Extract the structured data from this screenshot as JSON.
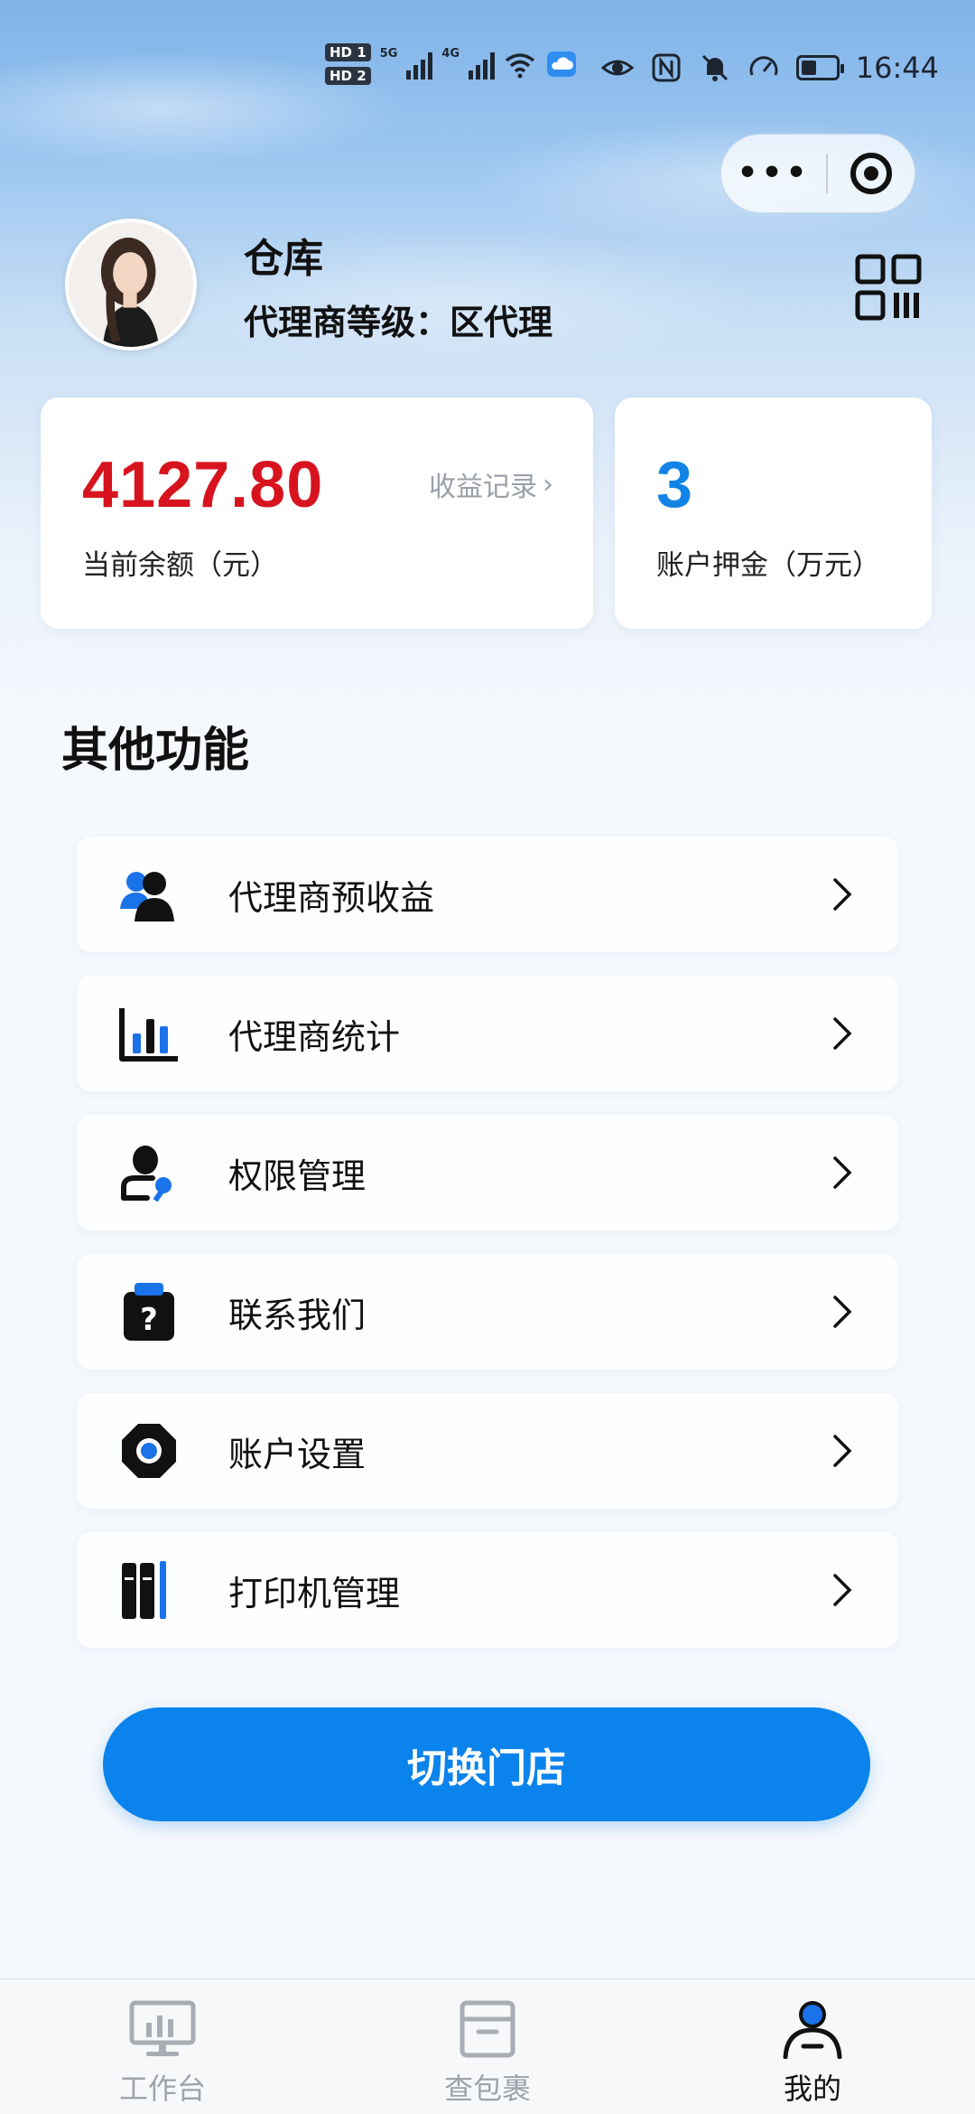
{
  "status_bar": {
    "time": "16:44",
    "hd1": "HD 1",
    "hd2": "HD 2",
    "net1": "5G",
    "net2": "4G",
    "icons": [
      "signal-icon",
      "wifi-icon",
      "cloud-icon",
      "eye-icon",
      "nfc-icon",
      "mute-icon",
      "speed-icon",
      "battery-icon"
    ]
  },
  "capsule": {
    "more_label": "•••"
  },
  "profile": {
    "name": "仓库",
    "level": "代理商等级：区代理"
  },
  "balance_card": {
    "value": "4127.80",
    "label": "当前余额（元）",
    "link_label": "收益记录",
    "link_chevron": "›"
  },
  "deposit_card": {
    "value": "3",
    "label": "账户押金（万元）"
  },
  "section": {
    "title": "其他功能"
  },
  "menu": {
    "items": [
      {
        "label": "代理商预收益",
        "icon": "users-icon"
      },
      {
        "label": "代理商统计",
        "icon": "bar-chart-icon"
      },
      {
        "label": "权限管理",
        "icon": "user-key-icon"
      },
      {
        "label": "联系我们",
        "icon": "help-clipboard-icon"
      },
      {
        "label": "账户设置",
        "icon": "settings-icon"
      },
      {
        "label": "打印机管理",
        "icon": "printer-binders-icon"
      }
    ]
  },
  "switch_button": {
    "label": "切换门店"
  },
  "tab_bar": {
    "tabs": [
      {
        "label": "工作台",
        "icon": "monitor-icon",
        "active": false
      },
      {
        "label": "查包裹",
        "icon": "box-icon",
        "active": false
      },
      {
        "label": "我的",
        "icon": "person-icon",
        "active": true
      }
    ]
  },
  "colors": {
    "accent": "#0b83ec",
    "balance_red": "#d7141e",
    "deposit_blue": "#1283e6"
  }
}
